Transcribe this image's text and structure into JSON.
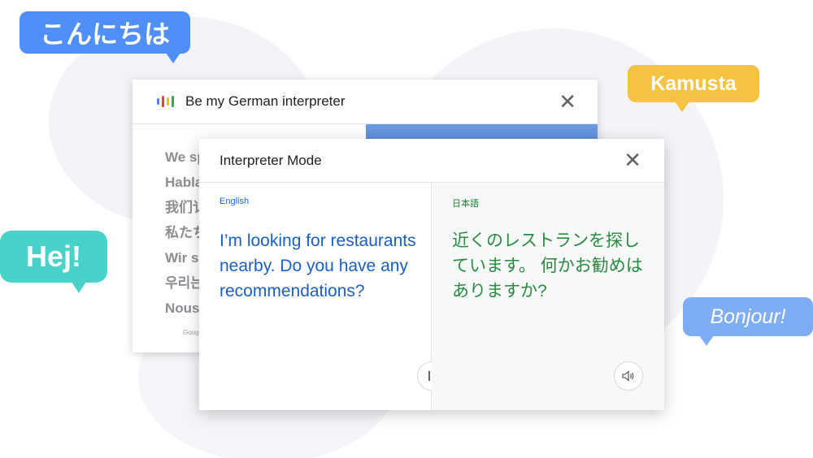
{
  "bubbles": {
    "japanese": "こんにちは",
    "filipino": "Kamusta",
    "swedish": "Hej!",
    "french": "Bonjour!"
  },
  "back_card": {
    "title": "Be my German interpreter",
    "lines": [
      "We sp",
      "Habla",
      "我们讠",
      "私たち",
      "Wir s",
      "우리는",
      "Nous"
    ],
    "footer": "Google"
  },
  "front_card": {
    "title": "Interpreter Mode",
    "source_language": "English",
    "source_text": "I’m looking for restaurants nearby. Do you have any recommendations?",
    "target_language": "日本語",
    "target_text": "近くのレストランを探しています。 何かお勧めはありますか?"
  },
  "icons": {
    "mic": "google-assistant-bars-icon",
    "close": "close-icon",
    "pause": "pause-icon",
    "speaker": "speaker-icon"
  },
  "colors": {
    "blue": "#4285f4",
    "red": "#ea4335",
    "yellow": "#fbbc05",
    "green": "#34a853"
  }
}
